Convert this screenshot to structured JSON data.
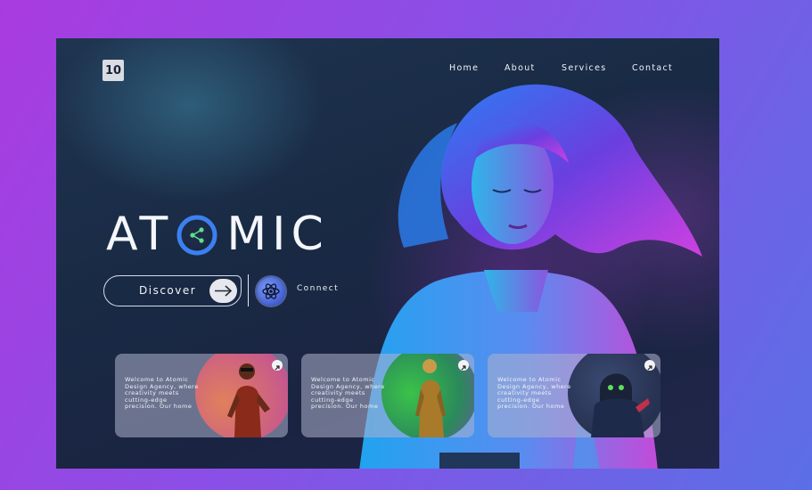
{
  "brand": {
    "logo_text": "10"
  },
  "nav": {
    "items": [
      {
        "label": "Home"
      },
      {
        "label": "About"
      },
      {
        "label": "Services"
      },
      {
        "label": "Contact"
      }
    ]
  },
  "hero": {
    "title_before": "AT",
    "title_after": "MIC",
    "discover_label": "Discover",
    "connect_label": "Connect"
  },
  "cards": [
    {
      "text": "Welcome to Atomic Design Agency, where creativity meets cutting-edge precision. Our home",
      "accent": "#d9705a"
    },
    {
      "text": "Welcome to Atomic Design Agency, where creativity meets cutting-edge precision. Our home",
      "accent": "#3bb24a"
    },
    {
      "text": "Welcome to Atomic Design Agency, where creativity meets cutting-edge precision. Our home",
      "accent": "#26304f"
    }
  ],
  "colors": {
    "background": "#9a45e4",
    "panel": "#1b2a45",
    "accent_blue": "#3d7ff0",
    "accent_magenta": "#c04fd8",
    "text": "#f1f3f8"
  },
  "icons": {
    "o_letter": "share-nodes-icon",
    "discover": "arrow-right-icon",
    "connect": "atom-icon",
    "card": "arrow-up-right-icon"
  }
}
